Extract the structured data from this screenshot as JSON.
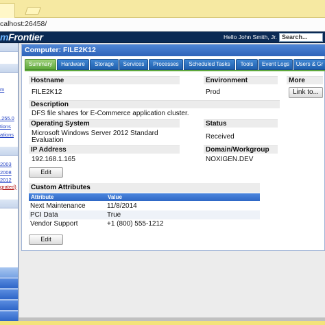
{
  "browser": {
    "address": "calhost:26458/"
  },
  "header": {
    "logo_main": "m",
    "logo_rest": "Frontier",
    "hello_text": "Hello John Smith, Jr.",
    "search_label": "Search..."
  },
  "sidebar": {
    "links": [
      "m",
      "tions",
      "ations",
      ".255.0",
      "2003",
      "2008",
      "2012",
      "grated)"
    ]
  },
  "panel": {
    "title": "Computer: FILE2K12",
    "tabs": [
      "Summary",
      "Hardware",
      "Storage",
      "Services",
      "Processes",
      "Scheduled Tasks",
      "Tools",
      "Event Logs",
      "Users & Gr"
    ],
    "active_tab": "Summary"
  },
  "summary": {
    "hostname_label": "Hostname",
    "hostname": "FILE2K12",
    "environment_label": "Environment",
    "environment": "Prod",
    "more_label": "More",
    "link_button": "Link to...",
    "description_label": "Description",
    "description": "DFS file shares for E-Commerce application cluster.",
    "os_label": "Operating System",
    "os_line1": "Microsoft Windows Server 2012 Standard",
    "os_line2": "Evaluation",
    "status_label": "Status",
    "status": "Received",
    "ip_label": "IP Address",
    "ip": "192.168.1.165",
    "domain_label": "Domain/Workgroup",
    "domain": "NOXIGEN.DEV",
    "edit_button": "Edit"
  },
  "custom_attributes": {
    "title": "Custom Attributes",
    "col_attribute": "Attribute",
    "col_value": "Value",
    "rows": [
      {
        "attribute": "Next Maintenance",
        "value": "11/8/2014"
      },
      {
        "attribute": "PCI Data",
        "value": "True"
      },
      {
        "attribute": "Vendor Support",
        "value": "+1 (800) 555-1212"
      }
    ],
    "edit_button": "Edit"
  },
  "colors": {
    "header_bg": "#0b2a54",
    "tab_blue": "#2f6fc0",
    "tab_active_green": "#5ea83c",
    "panel_title_blue": "#3a72c8"
  }
}
